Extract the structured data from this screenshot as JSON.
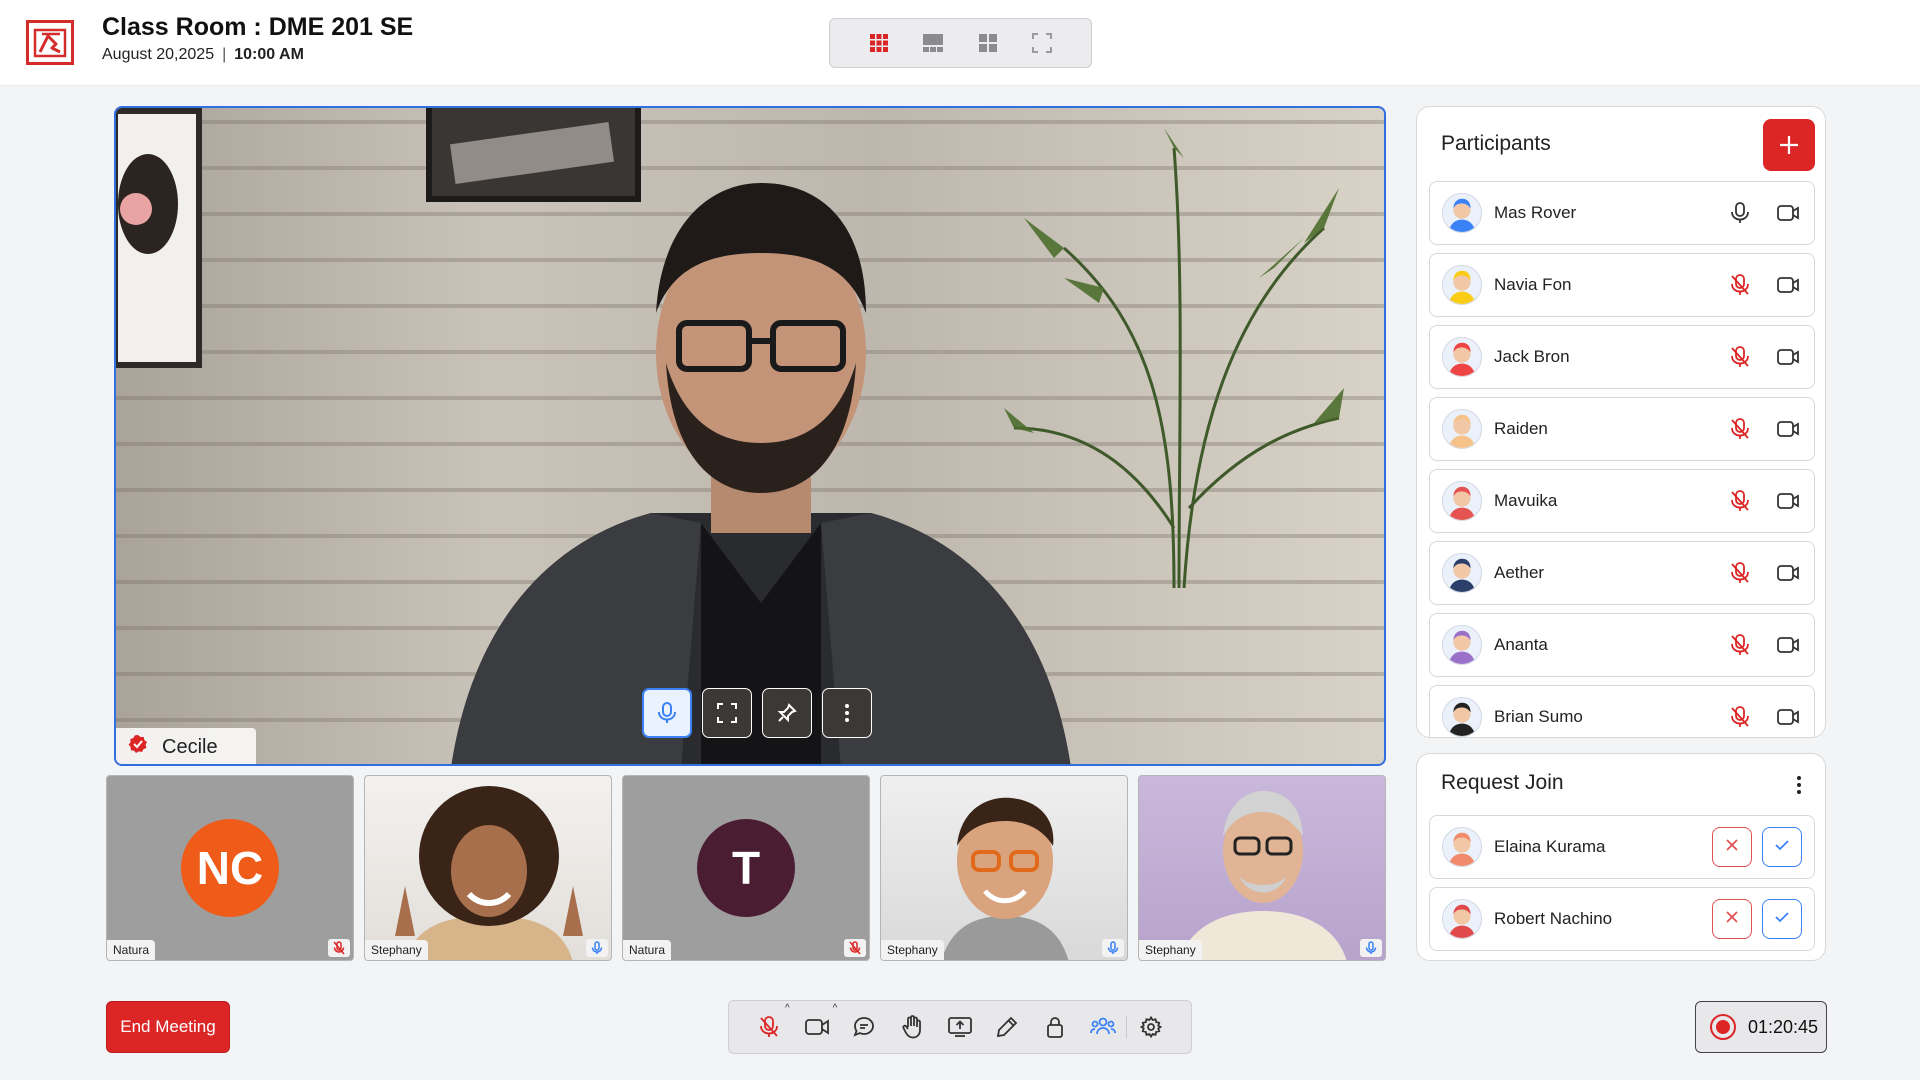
{
  "header": {
    "title": "Class Room : DME 201 SE",
    "date": "August 20,2025",
    "separator": "|",
    "time": "10:00 AM",
    "layout_icons": [
      "grid-3x3-icon",
      "speaker-layout-icon",
      "grid-2x2-icon",
      "fullscreen-icon"
    ]
  },
  "main_video": {
    "speaker_name": "Cecile",
    "controls": [
      "mic-icon",
      "expand-icon",
      "pin-icon",
      "more-vertical-icon"
    ]
  },
  "thumbnails": [
    {
      "label": "Natura",
      "initials": "NC",
      "avatar_color": "#ef5b18",
      "mic": "muted"
    },
    {
      "label": "Stephany",
      "initials": "",
      "mic": "on"
    },
    {
      "label": "Natura",
      "initials": "T",
      "avatar_color": "#4a1d33",
      "mic": "muted"
    },
    {
      "label": "Stephany",
      "initials": "",
      "mic": "on"
    },
    {
      "label": "Stephany",
      "initials": "",
      "mic": "on"
    }
  ],
  "participants": {
    "title": "Participants",
    "items": [
      {
        "name": "Mas Rover",
        "mic": "on",
        "avatar_color": "#3b82f6"
      },
      {
        "name": "Navia Fon",
        "mic": "muted",
        "avatar_color": "#facc15"
      },
      {
        "name": "Jack Bron",
        "mic": "muted",
        "avatar_color": "#ef4444"
      },
      {
        "name": "Raiden",
        "mic": "muted",
        "avatar_color": "#f5c28a"
      },
      {
        "name": "Mavuika",
        "mic": "muted",
        "avatar_color": "#e55353"
      },
      {
        "name": "Aether",
        "mic": "muted",
        "avatar_color": "#2b3f6b"
      },
      {
        "name": "Ananta",
        "mic": "muted",
        "avatar_color": "#9a70c9"
      },
      {
        "name": "Brian Sumo",
        "mic": "muted",
        "avatar_color": "#222222"
      }
    ]
  },
  "request_join": {
    "title": "Request Join",
    "items": [
      {
        "name": "Elaina Kurama",
        "avatar_color": "#f08a6a"
      },
      {
        "name": "Robert Nachino",
        "avatar_color": "#e04a4a"
      }
    ]
  },
  "footer": {
    "end_label": "End Meeting",
    "timer": "01:20:45",
    "toolbar_icons": [
      "mic-off-icon",
      "camera-icon",
      "chat-icon",
      "raise-hand-icon",
      "share-screen-icon",
      "pen-icon",
      "lock-icon",
      "participants-icon",
      "settings-icon"
    ]
  },
  "colors": {
    "accent": "#dc2626",
    "focus": "#2f6fe0",
    "muted_mic": "#dc2626",
    "active_mic": "#3b82f6"
  }
}
